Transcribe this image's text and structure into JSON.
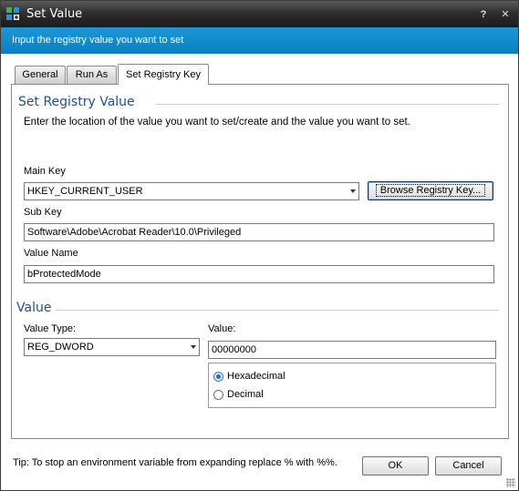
{
  "window": {
    "title": "Set Value",
    "help_glyph": "?",
    "close_glyph": "✕"
  },
  "banner": {
    "text": "Input the registry value you want to set"
  },
  "tabs": [
    {
      "label": "General"
    },
    {
      "label": "Run As"
    },
    {
      "label": "Set Registry Key",
      "active": true
    }
  ],
  "registry_section": {
    "title": "Set Registry Value",
    "description": "Enter the location of the value you want to set/create and the value you want to set.",
    "main_key_label": "Main Key",
    "main_key_value": "HKEY_CURRENT_USER",
    "browse_button": "Browse Registry Key...",
    "sub_key_label": "Sub Key",
    "sub_key_value": "Software\\Adobe\\Acrobat Reader\\10.0\\Privileged",
    "value_name_label": "Value Name",
    "value_name_value": "bProtectedMode"
  },
  "value_section": {
    "title": "Value",
    "value_type_label": "Value Type:",
    "value_type_selected": "REG_DWORD",
    "value_label": "Value:",
    "value_value": "00000000",
    "radio_options": [
      {
        "label": "Hexadecimal",
        "checked": true
      },
      {
        "label": "Decimal",
        "checked": false
      }
    ]
  },
  "footer": {
    "tip": "Tip: To stop an environment variable from expanding replace % with %%.",
    "ok_label": "OK",
    "cancel_label": "Cancel"
  },
  "colors": {
    "banner": "#1d97d6",
    "section_title": "#1b4f9a",
    "titlebar": "#2e2e2e"
  }
}
